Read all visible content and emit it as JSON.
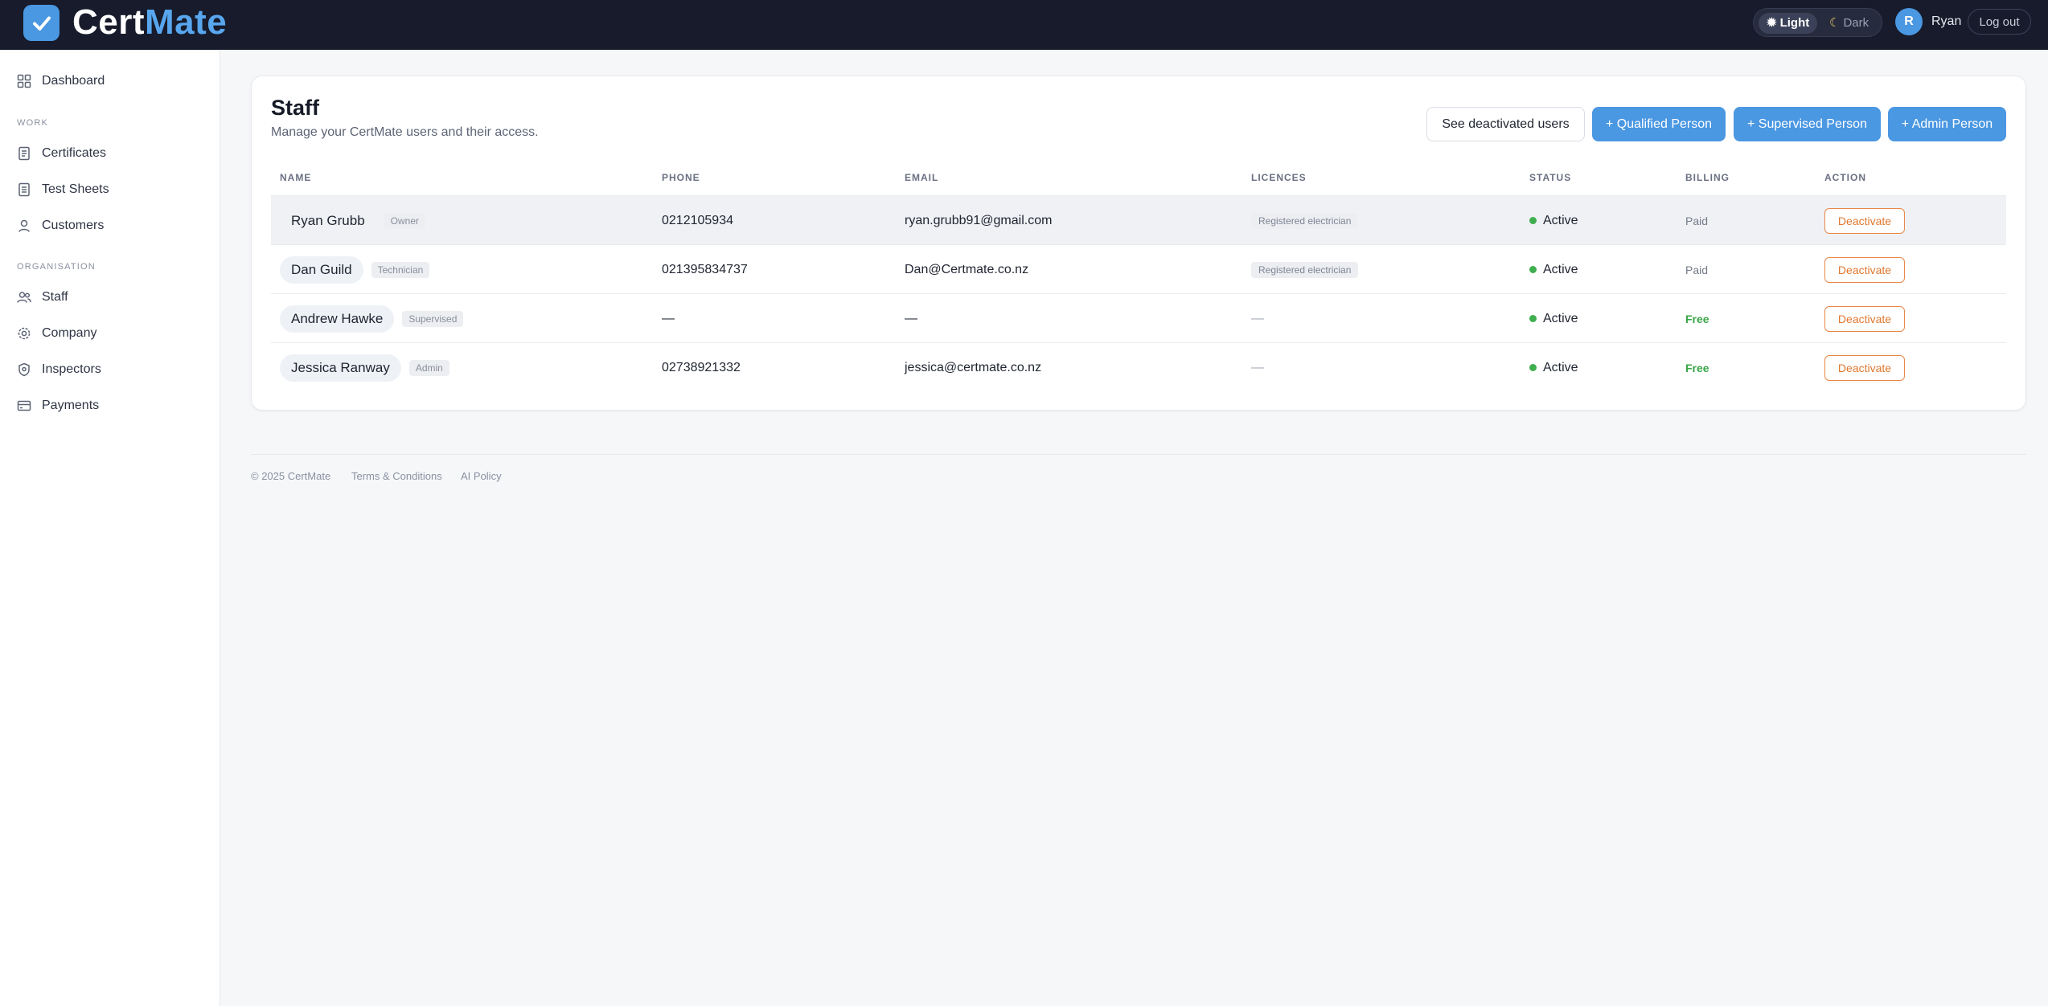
{
  "app": {
    "name_part1": "Cert",
    "name_part2": "Mate",
    "brand_color": "#4a97e2"
  },
  "topbar": {
    "theme_light": "Light",
    "theme_dark": "Dark",
    "user_initial": "R",
    "user_name": "Ryan",
    "logout": "Log out"
  },
  "sidebar": {
    "dashboard": {
      "label": "Dashboard",
      "icon": "grid-icon"
    },
    "work_section": "WORK",
    "work_items": [
      {
        "label": "Certificates",
        "icon": "document-icon"
      },
      {
        "label": "Test Sheets",
        "icon": "clipboard-icon"
      },
      {
        "label": "Customers",
        "icon": "user-icon"
      }
    ],
    "org_section": "ORGANISATION",
    "org_items": [
      {
        "label": "Staff",
        "icon": "users-icon"
      },
      {
        "label": "Company",
        "icon": "gear-icon"
      },
      {
        "label": "Inspectors",
        "icon": "shield-icon"
      },
      {
        "label": "Payments",
        "icon": "card-icon"
      }
    ]
  },
  "page": {
    "title": "Staff",
    "subtitle": "Manage your CertMate users and their access.",
    "see_deactivated": "See deactivated users",
    "add_qualified": "+ Qualified Person",
    "add_supervised": "+ Supervised Person",
    "add_admin": "+ Admin Person"
  },
  "table": {
    "headers": [
      "NAME",
      "PHONE",
      "EMAIL",
      "LICENCES",
      "STATUS",
      "BILLING",
      "ACTION"
    ],
    "rows": [
      {
        "name": "Ryan Grubb",
        "role": "Owner",
        "phone": "0212105934",
        "email": "ryan.grubb91@gmail.com",
        "licence": "Registered electrician",
        "status": "Active",
        "billing": "Paid",
        "action": "Deactivate"
      },
      {
        "name": "Dan Guild",
        "role": "Technician",
        "phone": "021395834737",
        "email": "Dan@Certmate.co.nz",
        "licence": "Registered electrician",
        "status": "Active",
        "billing": "Paid",
        "action": "Deactivate"
      },
      {
        "name": "Andrew Hawke",
        "role": "Supervised",
        "phone": "—",
        "email": "—",
        "licence": "—",
        "status": "Active",
        "billing": "Free",
        "action": "Deactivate"
      },
      {
        "name": "Jessica Ranway",
        "role": "Admin",
        "phone": "02738921332",
        "email": "jessica@certmate.co.nz",
        "licence": "—",
        "status": "Active",
        "billing": "Free",
        "action": "Deactivate"
      }
    ]
  },
  "footer": {
    "copyright": "© 2025 CertMate",
    "terms": "Terms & Conditions",
    "ai_policy": "AI Policy"
  }
}
